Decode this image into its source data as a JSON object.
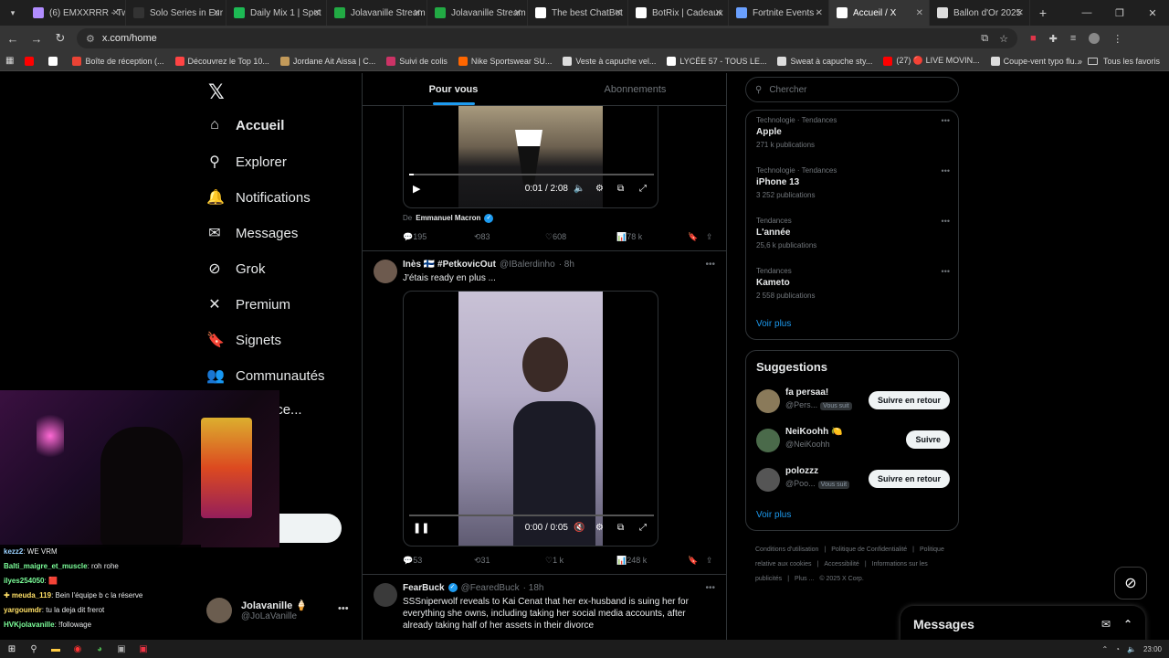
{
  "browser": {
    "tabs": [
      {
        "label": "(6) EMXXRRR - Tw",
        "fav": "#b18cff"
      },
      {
        "label": "Solo Series in Eur",
        "fav": "#333333"
      },
      {
        "label": "Daily Mix 1 | Spot",
        "fav": "#1db954"
      },
      {
        "label": "Jolavanille Stream",
        "fav": "#22aa44"
      },
      {
        "label": "Jolavanille Stream",
        "fav": "#22aa44"
      },
      {
        "label": "The best ChatBot",
        "fav": "#ffffff"
      },
      {
        "label": "BotRix | Cadeaux",
        "fav": "#ffffff"
      },
      {
        "label": "Fortnite Events -",
        "fav": "#6aa0ff"
      },
      {
        "label": "Accueil / X",
        "fav": "#ffffff"
      },
      {
        "label": "Ballon d'Or 2025",
        "fav": "#dddddd"
      }
    ],
    "url": "x.com/home",
    "bookmarks": [
      {
        "label": "",
        "color": "#ff0000"
      },
      {
        "label": "",
        "color": "#ffffff"
      },
      {
        "label": "Boîte de réception (...",
        "color": "#ea4335"
      },
      {
        "label": "Découvrez le Top 10...",
        "color": "#ff4444"
      },
      {
        "label": "Jordane Ait Aissa | C...",
        "color": "#c29a5a"
      },
      {
        "label": "Suivi de colis",
        "color": "#cc3366"
      },
      {
        "label": "Nike Sportswear SU...",
        "color": "#ff6600"
      },
      {
        "label": "Veste à capuche vel...",
        "color": "#dddddd"
      },
      {
        "label": "LYCÉE 57 - TOUS LE...",
        "color": "#ffffff"
      },
      {
        "label": "Sweat à capuche sty...",
        "color": "#dddddd"
      },
      {
        "label": "(27) 🔴 LIVE MOVIN...",
        "color": "#ff0000"
      },
      {
        "label": "Coupe-vent typo flu...",
        "color": "#dddddd"
      }
    ],
    "all_bookmarks": "Tous les favoris"
  },
  "nav": {
    "items": [
      {
        "label": "Accueil",
        "icon": "home-icon",
        "glyph": "⌂"
      },
      {
        "label": "Explorer",
        "icon": "search-icon",
        "glyph": "⚲"
      },
      {
        "label": "Notifications",
        "icon": "bell-icon",
        "glyph": "🔔"
      },
      {
        "label": "Messages",
        "icon": "mail-icon",
        "glyph": "✉"
      },
      {
        "label": "Grok",
        "icon": "grok-icon",
        "glyph": "⊘"
      },
      {
        "label": "Premium",
        "icon": "x-icon",
        "glyph": "✕"
      },
      {
        "label": "Signets",
        "icon": "bookmark-icon",
        "glyph": "🔖"
      },
      {
        "label": "Communautés",
        "icon": "communities-icon",
        "glyph": "👥"
      },
      {
        "label": "ations ce...",
        "icon": "",
        "glyph": ""
      }
    ],
    "post_label": "er",
    "profile": {
      "name": "Jolavanille 🍦",
      "handle": "@JoLaVanille"
    }
  },
  "timeline": {
    "tabs": [
      "Pour vous",
      "Abonnements"
    ],
    "tweet1": {
      "time": "0:01 / 2:08",
      "attribution_prefix": "De",
      "attribution_name": "Emmanuel Macron",
      "replies": "195",
      "reposts": "83",
      "likes": "608",
      "views": "78 k"
    },
    "tweet2": {
      "name": "Inès 🇫🇮 #PetkovicOut",
      "handle": "@IBalerdinho",
      "age": "· 8h",
      "text": "J'étais ready en plus ...",
      "time": "0:00 / 0:05",
      "replies": "53",
      "reposts": "31",
      "likes": "1 k",
      "views": "248 k"
    },
    "tweet3": {
      "name": "FearBuck",
      "handle": "@FearedBuck",
      "age": "· 18h",
      "text": "SSSniperwolf reveals to Kai Cenat that her ex-husband is suing her for everything she owns, including taking her social media accounts, after already taking half of her assets in their divorce"
    }
  },
  "sidebar": {
    "search_placeholder": "Chercher",
    "trends": [
      {
        "category": "Technologie · Tendances",
        "name": "Apple",
        "count": "271 k publications"
      },
      {
        "category": "Technologie · Tendances",
        "name": "iPhone 13",
        "count": "3 252 publications"
      },
      {
        "category": "Tendances",
        "name": "L'année",
        "count": "25,6 k publications"
      },
      {
        "category": "Tendances",
        "name": "Kameto",
        "count": "2 558 publications"
      }
    ],
    "see_more": "Voir plus",
    "suggestions_title": "Suggestions",
    "suggestions": [
      {
        "name": "fa persaa!",
        "handle": "@Pers...",
        "badge": "Vous suit",
        "button": "Suivre en retour"
      },
      {
        "name": "NeiKoohh 🍋",
        "handle": "@NeiKoohh",
        "badge": "",
        "button": "Suivre"
      },
      {
        "name": "polozzz",
        "handle": "@Poo...",
        "badge": "Vous suit",
        "button": "Suivre en retour"
      }
    ],
    "see_more_2": "Voir plus",
    "footer": [
      "Conditions d'utilisation",
      "|",
      "Politique de Confidentialité",
      "|",
      "Politique relative aux cookies",
      "|",
      "Accessibilité",
      "|",
      "Informations sur les publicités",
      "|",
      "Plus ...",
      "© 2025 X Corp."
    ]
  },
  "messages_drawer": "Messages",
  "stream": {
    "chat": [
      {
        "user": "kezz2",
        "color": "#9ad1ff",
        "msg": ": WE VRM"
      },
      {
        "user": "Balti_maigre_et_muscle",
        "color": "#7cff9a",
        "msg": ": roh rohe"
      },
      {
        "user": "ilyes254050",
        "color": "#7cff9a",
        "msg": ": 🟥"
      },
      {
        "user": "✚ meuda_119",
        "color": "#ffe066",
        "msg": ": Bein l'équipe b c la réserve"
      },
      {
        "user": "yargoumdr",
        "color": "#ffe066",
        "msg": ": tu la deja dit frerot"
      },
      {
        "user": "HVKjolavanille",
        "color": "#7cff9a",
        "msg": ": !followage"
      }
    ]
  },
  "system": {
    "clock": "23:00"
  }
}
